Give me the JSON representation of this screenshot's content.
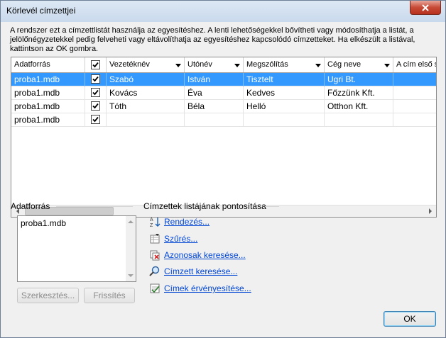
{
  "window": {
    "title": "Körlevél címzettjei"
  },
  "description": "A rendszer ezt a címzettlistát használja az egyesítéshez. A lenti lehetőségekkel bővítheti vagy módosíthatja a listát, a jelölőnégyzetekkel pedig felveheti vagy eltávolíthatja az egyesítéshez kapcsolódó címzetteket. Ha elkészült a listával, kattintson az OK gombra.",
  "grid": {
    "columns": [
      "Adatforrás",
      "",
      "Vezetéknév",
      "Utónév",
      "Megszólítás",
      "Cég neve",
      "A cím első s"
    ],
    "rows": [
      {
        "source": "proba1.mdb",
        "checked": true,
        "last_name": "Szabó",
        "first_name": "István",
        "salutation": "Tisztelt",
        "company": "Ugri Bt.",
        "address": ""
      },
      {
        "source": "proba1.mdb",
        "checked": true,
        "last_name": "Kovács",
        "first_name": "Éva",
        "salutation": "Kedves",
        "company": "Főzzünk Kft.",
        "address": ""
      },
      {
        "source": "proba1.mdb",
        "checked": true,
        "last_name": "Tóth",
        "first_name": "Béla",
        "salutation": "Helló",
        "company": "Otthon Kft.",
        "address": ""
      },
      {
        "source": "proba1.mdb",
        "checked": true,
        "last_name": "",
        "first_name": "",
        "salutation": "",
        "company": "",
        "address": ""
      }
    ],
    "selected_row": 0
  },
  "datasource": {
    "label": "Adatforrás",
    "items": [
      "proba1.mdb"
    ],
    "edit_button": "Szerkesztés...",
    "refresh_button": "Frissítés"
  },
  "refine": {
    "label": "Címzettek listájának pontosítása",
    "links": [
      {
        "label": "Rendezés...",
        "icon": "sort-az-icon"
      },
      {
        "label": "Szűrés...",
        "icon": "filter-icon"
      },
      {
        "label": "Azonosak keresése...",
        "icon": "find-duplicates-icon"
      },
      {
        "label": "Címzett keresése...",
        "icon": "find-recipient-icon"
      },
      {
        "label": "Címek érvényesítése...",
        "icon": "validate-addresses-icon"
      }
    ]
  },
  "ok_button": "OK",
  "colors": {
    "selection": "#3399ff",
    "link": "#0046d5",
    "close": "#c74a36"
  }
}
